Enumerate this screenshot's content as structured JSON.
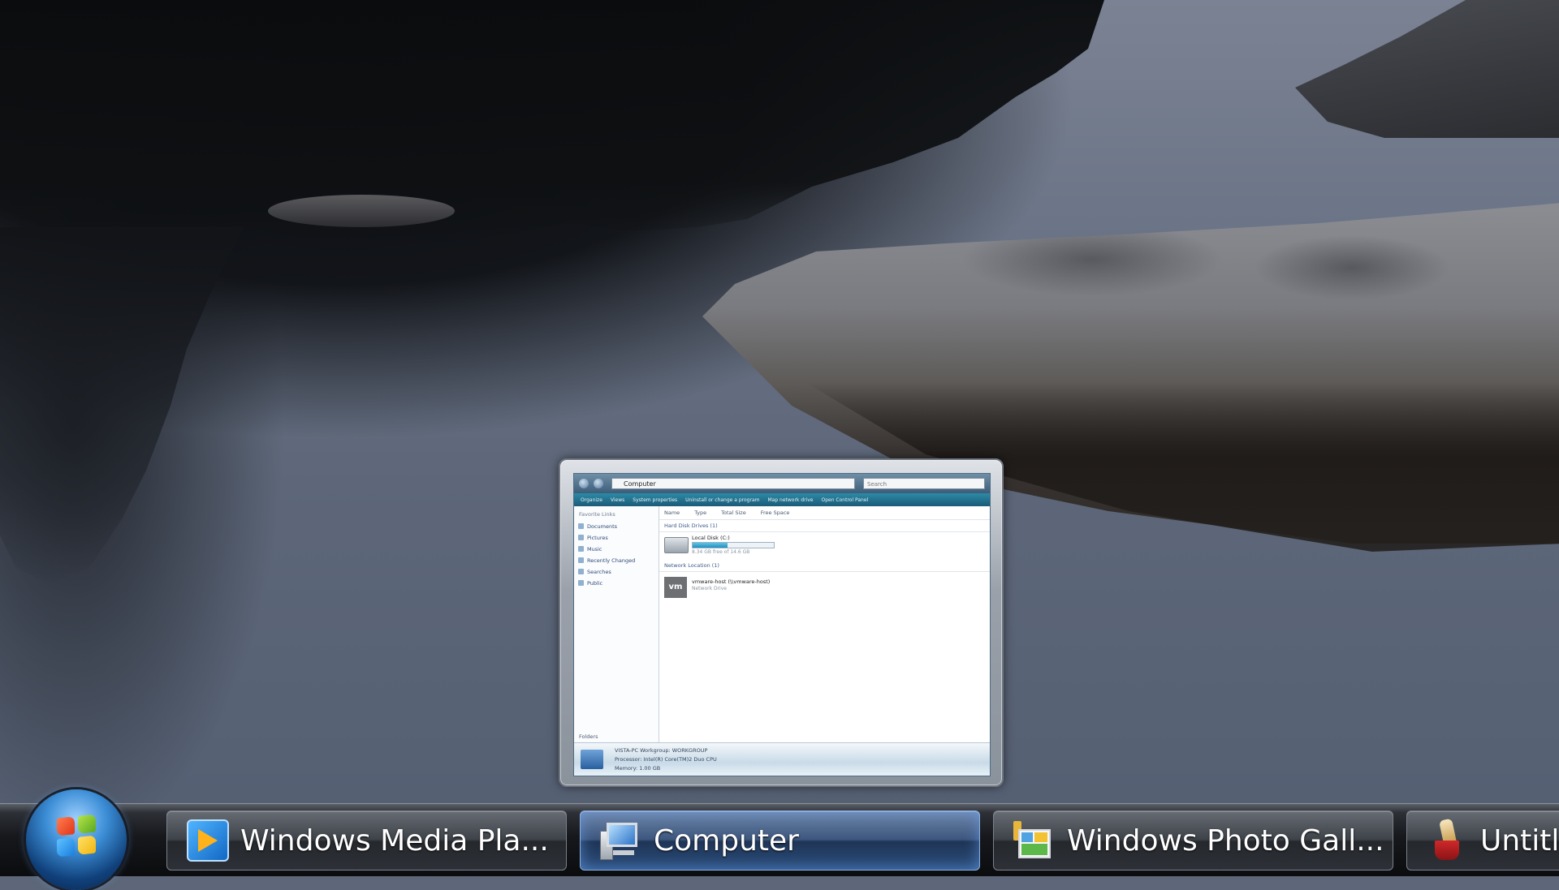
{
  "taskbar": {
    "start_button": {
      "icon": "windows-logo-icon"
    },
    "items": [
      {
        "label": "Windows Media Pla...",
        "icon": "media-player-icon",
        "active": false
      },
      {
        "label": "Computer",
        "icon": "computer-icon",
        "active": true
      },
      {
        "label": "Windows Photo Gall...",
        "icon": "photo-gallery-icon",
        "active": false
      },
      {
        "label": "Untitle",
        "icon": "paint-icon",
        "active": false
      }
    ]
  },
  "thumbnail_preview": {
    "window": "Computer",
    "address": "Computer",
    "search_placeholder": "Search",
    "commands": [
      "Organize",
      "Views",
      "System properties",
      "Uninstall or change a program",
      "Map network drive",
      "Open Control Panel"
    ],
    "nav_header": "Favorite Links",
    "nav_items": [
      "Documents",
      "Pictures",
      "Music",
      "Recently Changed",
      "Searches",
      "Public"
    ],
    "nav_folders_label": "Folders",
    "columns": [
      "Name",
      "Type",
      "Total Size",
      "Free Space"
    ],
    "sections": [
      {
        "header": "Hard Disk Drives (1)",
        "items": [
          {
            "name": "Local Disk (C:)",
            "sub": "8.34 GB free of 14.6 GB",
            "usage": 0.43
          }
        ]
      },
      {
        "header": "Network Location (1)",
        "items": [
          {
            "name": "vmware-host (\\\\vmware-host)",
            "sub": "Network Drive",
            "icon_text": "vm"
          }
        ]
      }
    ],
    "details": {
      "line1": "VISTA-PC  Workgroup: WORKGROUP",
      "line2": "Processor: Intel(R) Core(TM)2 Duo CPU",
      "line3": "Memory: 1.00 GB"
    }
  },
  "colors": {
    "taskbar_bg": "#16181c",
    "active_button": "#3d577f",
    "wallpaper_water": "#5d6779"
  }
}
